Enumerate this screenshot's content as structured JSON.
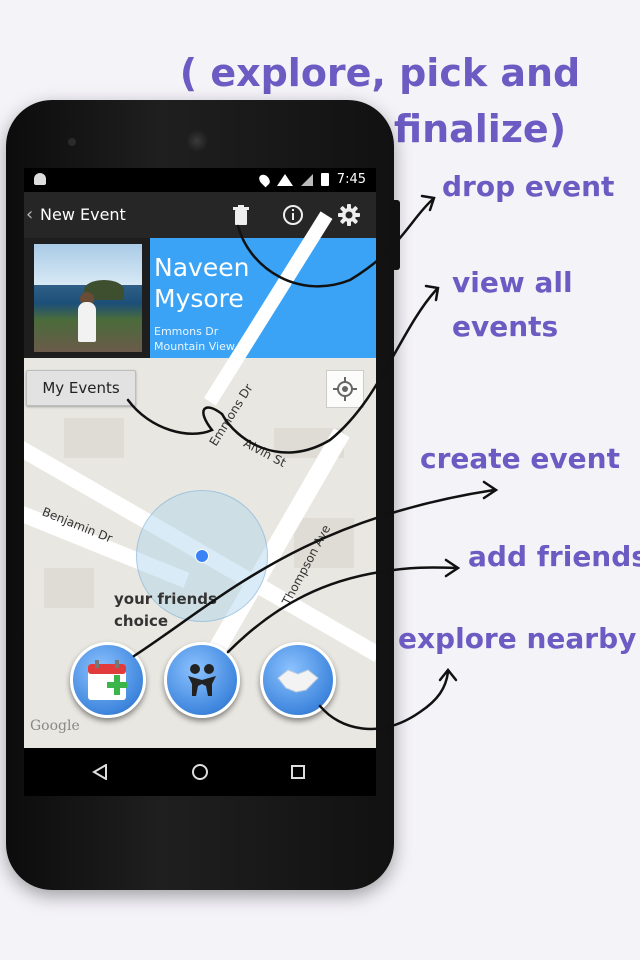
{
  "headline": {
    "line1": "( explore, pick and",
    "line2": "finalize)"
  },
  "statusbar": {
    "time": "7:45"
  },
  "actionbar": {
    "back_icon": "chevron-left-icon",
    "title": "New Event",
    "icons": [
      "trash-icon",
      "info-icon",
      "gear-icon"
    ]
  },
  "profile": {
    "name_line1": "Naveen",
    "name_line2": "Mysore",
    "address_line1": "Emmons Dr",
    "address_line2": "Mountain View"
  },
  "map": {
    "my_events_label": "My Events",
    "streets": [
      "Emmons Dr",
      "Alvin St",
      "Benjamin Dr",
      "Thompson Ave"
    ],
    "friends_label_line1": "your friends",
    "friends_label_line2": "choice",
    "attribution": "Google"
  },
  "annotations": {
    "drop_event": "drop event",
    "view_all_line1": "view all",
    "view_all_line2": "events",
    "create_event": "create event",
    "add_friends": "add friends",
    "explore_nearby": "explore nearby"
  },
  "colors": {
    "accent": "#6b5bc2",
    "profile_blue": "#3aa3f5",
    "fab_blue": "#3f86dd"
  }
}
